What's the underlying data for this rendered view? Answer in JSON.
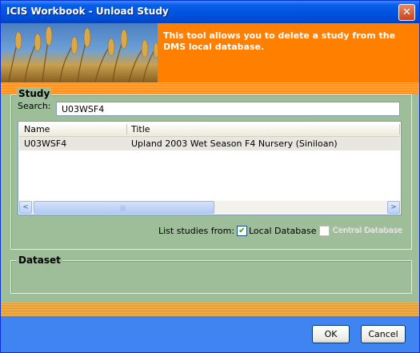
{
  "window": {
    "title": "ICIS Workbook - Unload Study",
    "close_glyph": "✕"
  },
  "banner": {
    "text": "This tool allows you to delete a study from the DMS local database."
  },
  "study": {
    "group_label": "Study",
    "search_label": "Search:",
    "search_value": "U03WSF4",
    "columns": [
      "Name",
      "Title"
    ],
    "rows": [
      {
        "name": "U03WSF4",
        "title": "Upland 2003 Wet Season F4 Nursery (Siniloan)"
      }
    ],
    "scroll_left_glyph": "<",
    "scroll_right_glyph": ">",
    "list_from_label": "List studies from:",
    "local_db_label": "Local Database",
    "local_db_checked": true,
    "central_db_label": "Central Database",
    "central_db_checked": false,
    "check_glyph": "✔"
  },
  "dataset": {
    "group_label": "Dataset"
  },
  "buttons": {
    "ok": "OK",
    "cancel": "Cancel"
  },
  "colors": {
    "banner_orange": "#ff7f00",
    "dialog_green": "#9dbe98",
    "footer_blue": "#3f84f0",
    "titlebar_blue": "#0054e3"
  }
}
